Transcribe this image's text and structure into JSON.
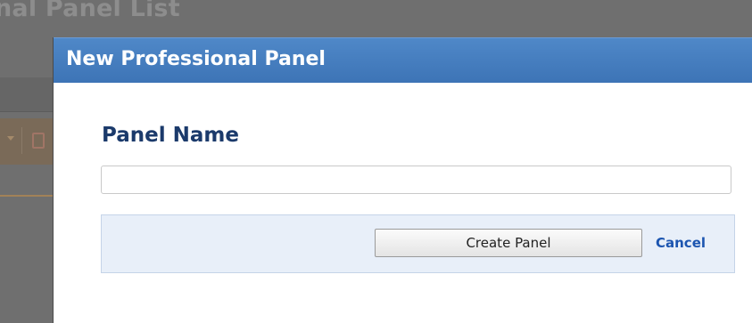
{
  "background": {
    "page_title": "nal Panel List"
  },
  "modal": {
    "title": "New Professional Panel",
    "field_label": "Panel Name",
    "panel_name_value": "",
    "panel_name_placeholder": "",
    "create_button_label": "Create Panel",
    "cancel_link_label": "Cancel"
  },
  "colors": {
    "header_blue": "#3d74b6",
    "label_navy": "#1b3a6b",
    "link_blue": "#1c55b0",
    "action_bar_bg": "#e8eff9",
    "overlay_gray": "#6f6f6f"
  },
  "icons": {
    "background_toolbar": [
      "dropdown-arrow-icon",
      "delete-icon"
    ]
  }
}
